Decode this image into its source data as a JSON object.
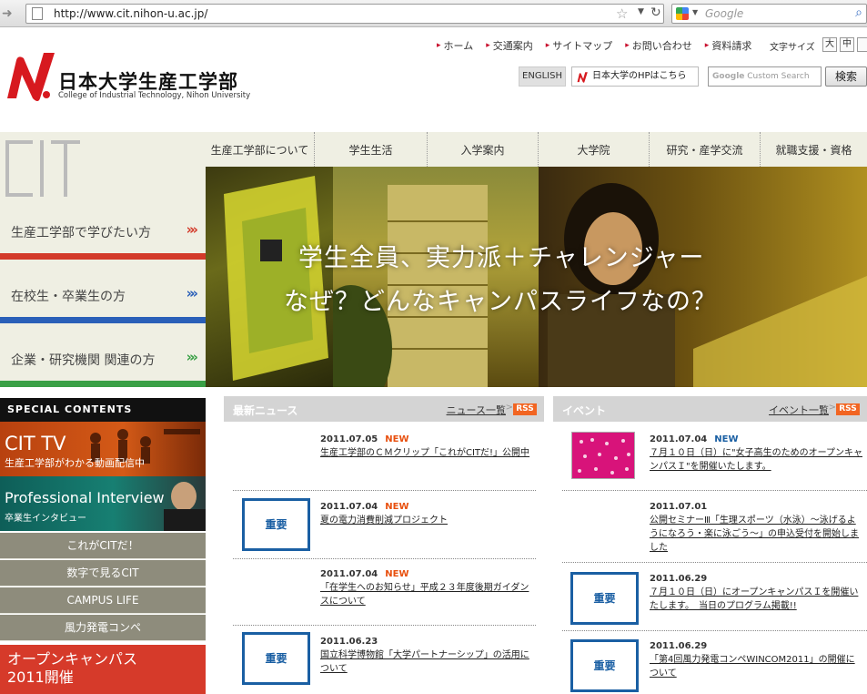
{
  "browser": {
    "url": "http://www.cit.nihon-u.ac.jp/",
    "search_placeholder": "Google"
  },
  "header": {
    "logo_title": "日本大学生産工学部",
    "logo_sub": "College of Industrial Technology, Nihon University",
    "topnav": [
      "ホーム",
      "交通案内",
      "サイトマップ",
      "お問い合わせ",
      "資料請求"
    ],
    "fontsize_label": "文字サイズ",
    "fontsize_large": "大",
    "fontsize_medium": "中",
    "english_label": "ENGLISH",
    "nu_link_label": "日本大学のHPはこちら",
    "custom_search_google": "Google",
    "custom_search_text": "Custom Search",
    "search_button": "検索"
  },
  "mainnav": [
    "生産工学部について",
    "学生生活",
    "入学案内",
    "大学院",
    "研究・産学交流",
    "就職支援・資格"
  ],
  "hero": {
    "caption_line1": "学生全員、実力派＋チャレンジャー",
    "caption_line2": "なぜ？どんなキャンパスライフなの？"
  },
  "audience": [
    {
      "label": "生産工学部で学びたい方",
      "color": "#d33a2a"
    },
    {
      "label": "在校生・卒業生の方",
      "color": "#2a5fb8"
    },
    {
      "label": "企業・研究機関 関連の方",
      "color": "#3aa046"
    }
  ],
  "special": {
    "header": "SPECIAL CONTENTS",
    "cittv_title": "CIT TV",
    "cittv_sub": "生産工学部がわかる動画配信中",
    "prof_title": "Professional Interview",
    "prof_sub": "卒業生インタビュー",
    "buttons": [
      "これがCITだ！",
      "数字で見るCIT",
      "CAMPUS LIFE",
      "風力発電コンペ"
    ],
    "opencampus_line1": "オープンキャンパス",
    "opencampus_line2": "2011開催"
  },
  "news": {
    "title": "最新ニュース",
    "more": "ニュース一覧",
    "rss": "RSS",
    "juyo": "重要",
    "new_label": "NEW",
    "items": [
      {
        "date": "2011.07.05",
        "new": true,
        "text": "生産工学部のＣＭクリップ「これがCITだ!」公開中"
      },
      {
        "date": "2011.07.04",
        "new": true,
        "text": "夏の電力消費削減プロジェクト"
      },
      {
        "date": "2011.07.04",
        "new": true,
        "text": "「在学生へのお知らせ」平成２３年度後期ガイダンスについて"
      },
      {
        "date": "2011.06.23",
        "new": false,
        "text": "国立科学博物館「大学パートナーシップ」の活用について"
      }
    ]
  },
  "events": {
    "title": "イベント",
    "more": "イベント一覧",
    "rss": "RSS",
    "items": [
      {
        "date": "2011.07.04",
        "new": true,
        "text": "７月１０日（日）に\"女子高生のためのオープンキャンパスＩ\"を開催いたします。"
      },
      {
        "date": "2011.07.01",
        "new": false,
        "text": "公開セミナーⅢ「生理スポーツ（水泳）～泳げるようになろう・楽に泳ごう～」の申込受付を開始しました"
      },
      {
        "date": "2011.06.29",
        "new": false,
        "text": "７月１０日（日）にオープンキャンパスＩを開催いたします。　当日のプログラム掲載!!"
      },
      {
        "date": "2011.06.29",
        "new": false,
        "text": "「第4回風力発電コンペWINCOM2011」の開催について"
      }
    ]
  }
}
